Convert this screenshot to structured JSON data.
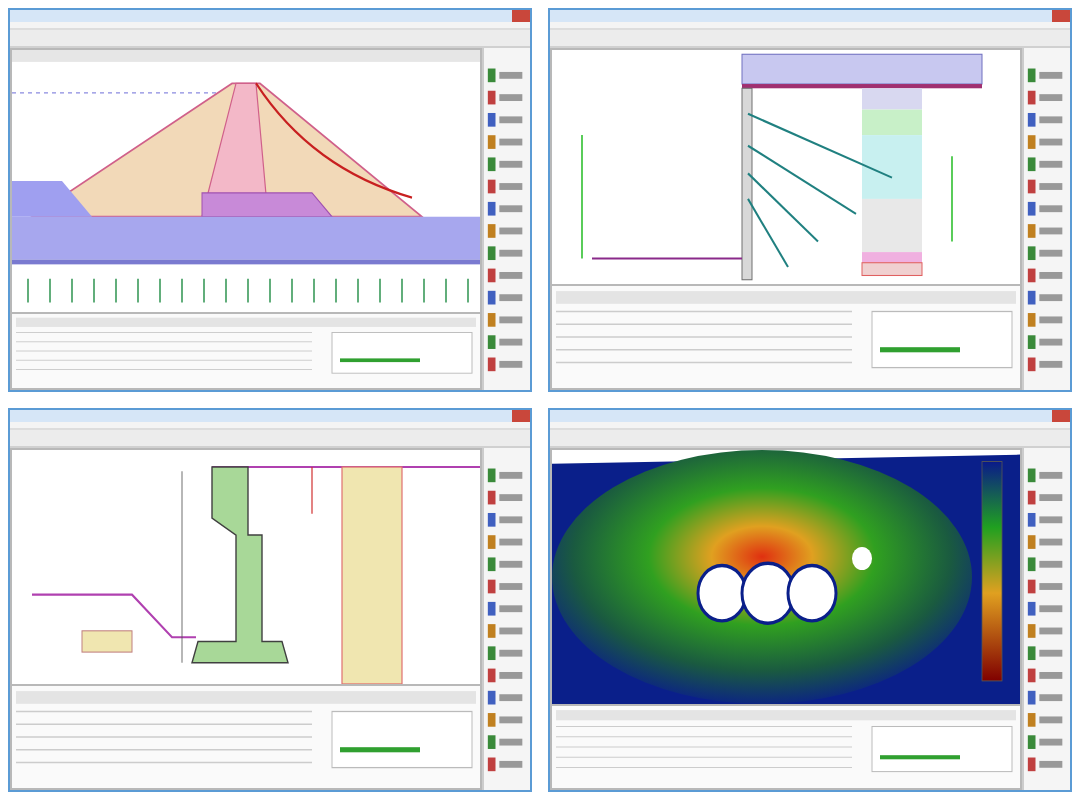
{
  "windows": [
    {
      "kind": "dam"
    },
    {
      "kind": "sheeting"
    },
    {
      "kind": "wall"
    },
    {
      "kind": "fem"
    }
  ]
}
